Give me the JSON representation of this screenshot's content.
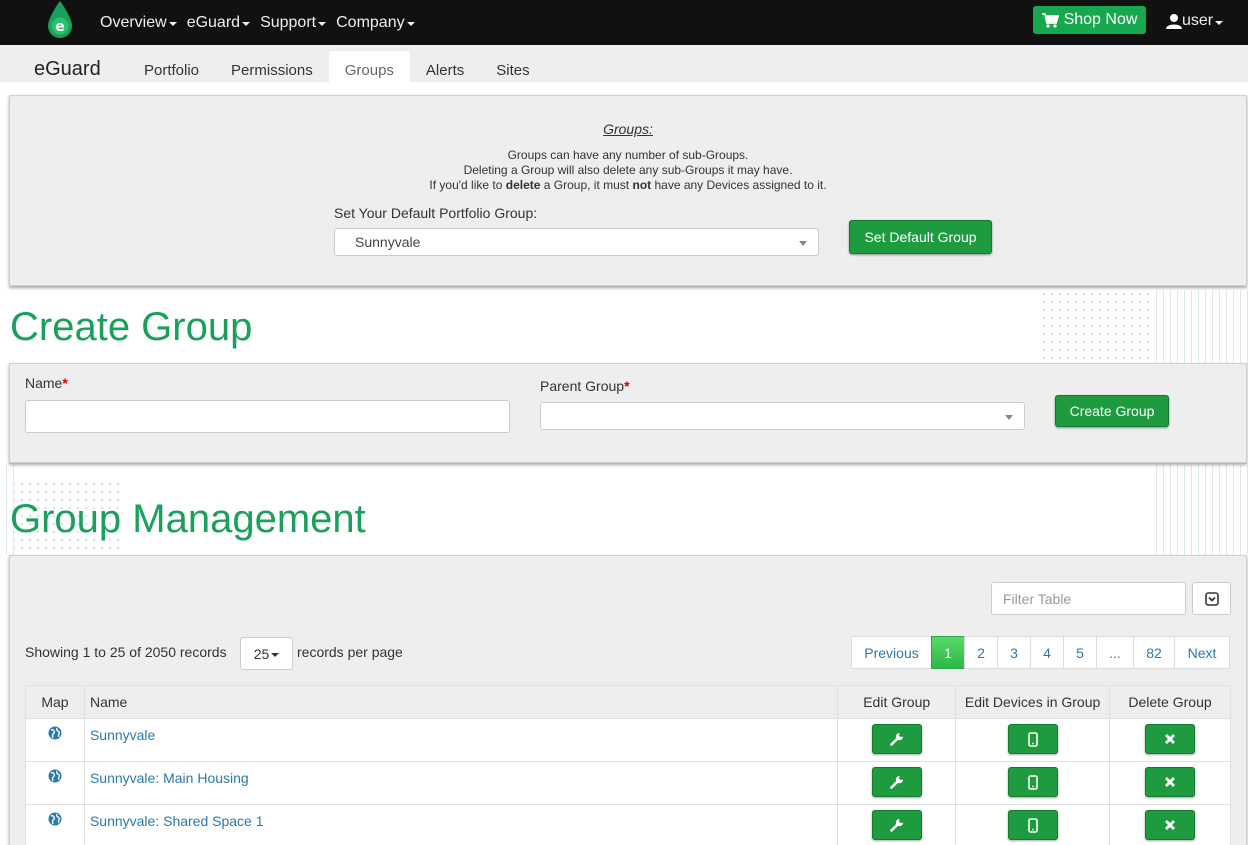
{
  "nav": {
    "items": [
      {
        "label": "Overview"
      },
      {
        "label": "eGuard"
      },
      {
        "label": "Support"
      },
      {
        "label": "Company"
      }
    ],
    "shop_label": "Shop Now",
    "user_label": "user",
    "logo_letter": "e"
  },
  "subnav": {
    "brand": "eGuard",
    "tabs": [
      "Portfolio",
      "Permissions",
      "Groups",
      "Alerts",
      "Sites"
    ],
    "active_tab": "Groups"
  },
  "groups_panel": {
    "title": "Groups:",
    "line1": "Groups can have any number of sub-Groups.",
    "line2": "Deleting a Group will also delete any sub-Groups it may have.",
    "line3_part1": "If you'd like to ",
    "line3_bold1": "delete",
    "line3_part2": " a Group, it must ",
    "line3_bold2": "not",
    "line3_part3": " have any Devices assigned to it.",
    "default_label": "Set Your Default Portfolio Group:",
    "default_value": "Sunnyvale",
    "set_default_button": "Set Default Group"
  },
  "create_group": {
    "heading": "Create Group",
    "name_label": "Name",
    "parent_label": "Parent Group",
    "required_mark": "*",
    "name_value": "",
    "parent_value": "",
    "create_button": "Create Group"
  },
  "management": {
    "heading": "Group Management",
    "filter_placeholder": "Filter Table",
    "showing_text": "Showing 1 to 25 of 2050 records",
    "page_size": "25",
    "per_page_text": "records per page",
    "pagination": [
      "Previous",
      "1",
      "2",
      "3",
      "4",
      "5",
      "...",
      "82",
      "Next"
    ],
    "current_page": "1",
    "columns": [
      "Map",
      "Name",
      "Edit Group",
      "Edit Devices in Group",
      "Delete Group"
    ],
    "rows": [
      {
        "name": "Sunnyvale"
      },
      {
        "name": "Sunnyvale: Main Housing"
      },
      {
        "name": "Sunnyvale: Shared Space 1"
      }
    ]
  },
  "colors": {
    "navbar": "#111111",
    "accent_green": "#1e9a3f",
    "heading_green": "#1aa05a",
    "link_blue": "#2a7ab0",
    "panel_bg": "#eeeeee"
  },
  "icons": {
    "logo": "egaurd-drop-logo",
    "shop": "shopping-cart-icon",
    "user": "user-icon",
    "map": "globe-icon",
    "edit_group": "wrench-icon",
    "edit_devices": "mobile-phone-icon",
    "delete": "close-icon",
    "toggle": "chevron-down-square-icon"
  }
}
